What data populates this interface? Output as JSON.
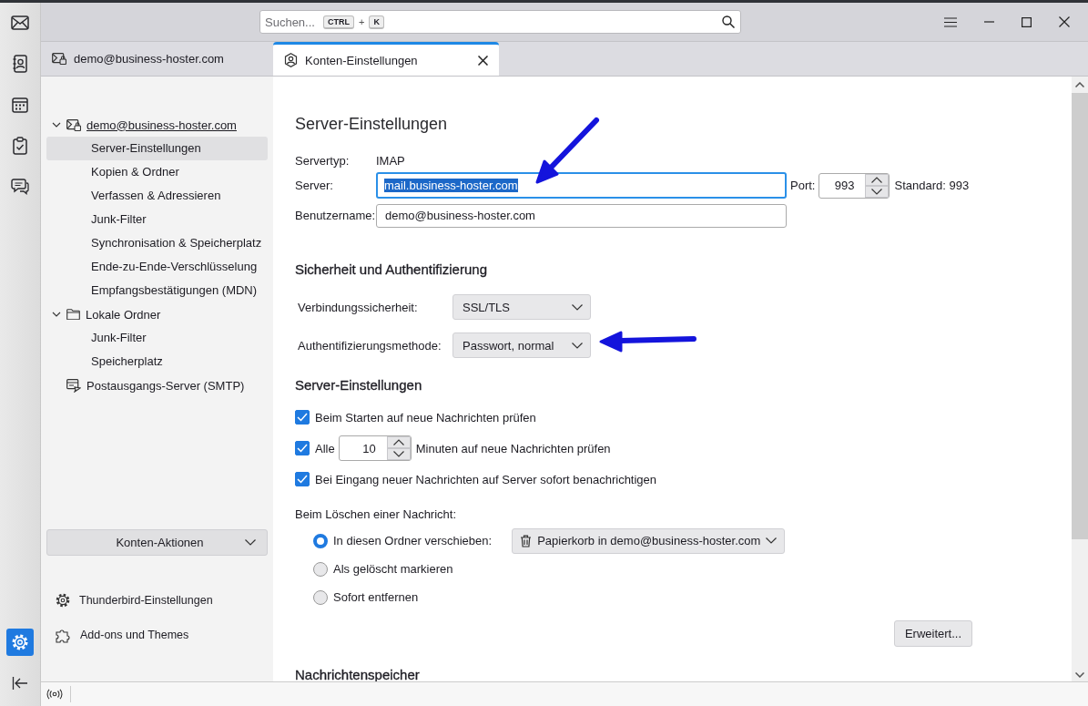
{
  "spaces_bar": {
    "top": [
      {
        "kind": "mail",
        "selected": false
      },
      {
        "kind": "contacts",
        "selected": false
      },
      {
        "kind": "calendar",
        "selected": false
      },
      {
        "kind": "tasks",
        "selected": false
      },
      {
        "kind": "chat",
        "selected": false
      }
    ],
    "bottom": [
      {
        "kind": "settings",
        "selected": true
      }
    ]
  },
  "search": {
    "placeholder": "Suchen...",
    "keys": [
      "CTRL",
      "K"
    ],
    "joiner": "+"
  },
  "tabs": [
    {
      "label": "demo@business-hoster.com",
      "kind": "account",
      "selected": false,
      "closable": false
    },
    {
      "label": "Konten-Einstellungen",
      "kind": "settings",
      "selected": true,
      "closable": true
    }
  ],
  "nav": {
    "accounts": [
      {
        "label": "demo@business-hoster.com",
        "kind": "mail",
        "expanded": true,
        "selected": false,
        "children": [
          {
            "label": "Server-Einstellungen",
            "selected": true
          },
          {
            "label": "Kopien & Ordner",
            "selected": false
          },
          {
            "label": "Verfassen & Adressieren",
            "selected": false
          },
          {
            "label": "Junk-Filter",
            "selected": false
          },
          {
            "label": "Synchronisation & Speicherplatz",
            "selected": false
          },
          {
            "label": "Ende-zu-Ende-Verschlüsselung",
            "selected": false
          },
          {
            "label": "Empfangsbestätigungen (MDN)",
            "selected": false
          }
        ]
      },
      {
        "label": "Lokale Ordner",
        "kind": "folder",
        "expanded": true,
        "selected": false,
        "children": [
          {
            "label": "Junk-Filter",
            "selected": false
          },
          {
            "label": "Speicherplatz",
            "selected": false
          }
        ]
      },
      {
        "label": "Postausgangs-Server (SMTP)",
        "kind": "smtp",
        "selected": false
      }
    ],
    "actions_button": "Konten-Aktionen",
    "footer": [
      {
        "label": "Thunderbird-Einstellungen",
        "kind": "gear"
      },
      {
        "label": "Add-ons und Themes",
        "kind": "puzzle"
      }
    ]
  },
  "page_title": "Server-Einstellungen",
  "server": {
    "type_label": "Servertyp:",
    "type_value": "IMAP",
    "server_label": "Server:",
    "server_value": "mail.business-hoster.com",
    "server_focused": true,
    "server_value_selected": true,
    "port_label": "Port:",
    "port_value": "993",
    "port_default": "Standard: 993",
    "user_label": "Benutzername:",
    "user_value": "demo@business-hoster.com"
  },
  "security": {
    "heading": "Sicherheit und Authentifizierung",
    "rows": [
      {
        "label": "Verbindungssicherheit:",
        "value": "SSL/TLS"
      },
      {
        "label": "Authentifizierungsmethode:",
        "value": "Passwort, normal"
      }
    ]
  },
  "server_settings": {
    "heading": "Server-Einstellungen",
    "checks": [
      {
        "kind": "plain",
        "label": "Beim Starten auf neue Nachrichten prüfen",
        "checked": true
      },
      {
        "kind": "interval",
        "label": "Alle",
        "value": "10",
        "suffix": "Minuten auf neue Nachrichten prüfen",
        "checked": true
      },
      {
        "kind": "plain",
        "label": "Bei Eingang neuer Nachrichten auf Server sofort benachrichtigen",
        "checked": true
      }
    ],
    "delete_label": "Beim Löschen einer Nachricht:",
    "delete_options": [
      {
        "label": "In diesen Ordner verschieben:",
        "selected": true,
        "folder": "Papierkorb in demo@business-hoster.com"
      },
      {
        "label": "Als gelöscht markieren",
        "selected": false
      },
      {
        "label": "Sofort entfernen",
        "selected": false
      }
    ],
    "advanced_button": "Erweitert..."
  },
  "storage_heading": "Nachrichtenspeicher"
}
